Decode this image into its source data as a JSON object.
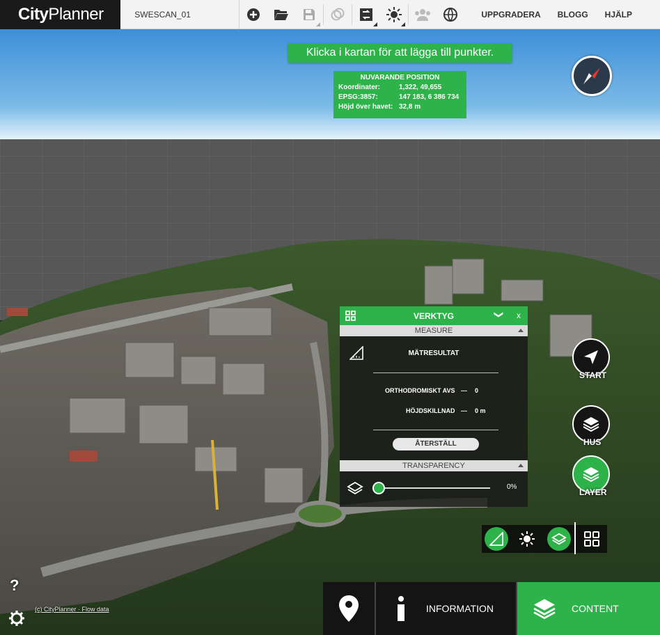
{
  "header": {
    "logo_bold": "City",
    "logo_light": "Planner",
    "project_name": "SWESCAN_01",
    "menu": [
      "UPPGRADERA",
      "BLOGG",
      "HJÄLP"
    ],
    "toolbar_icons": [
      "add-icon",
      "folder-open-icon",
      "save-icon",
      "duplicate-icon",
      "layers-swap-icon",
      "sun-icon",
      "users-icon",
      "globe-icon"
    ]
  },
  "map": {
    "instruction": "Klicka i kartan för att lägga till punkter.",
    "position": {
      "title": "NUVARANDE POSITION",
      "rows": [
        {
          "label": "Koordinater:",
          "value": "1,322, 49,655"
        },
        {
          "label": "EPSG:3857:",
          "value": "147 183, 6 386 734"
        },
        {
          "label": "Höjd över havet:",
          "value": "32,8 m"
        }
      ]
    },
    "credit": "(c) CityPlanner · Flow data"
  },
  "panel": {
    "title": "VERKTYG",
    "minimize": "❯",
    "close": "x",
    "measure_section": "MEASURE",
    "result_title": "MÄTRESULTAT",
    "ortho_label": "ORTHODROMISKT AVS",
    "ortho_dash": "---",
    "ortho_value": "0",
    "height_label": "HÖJDSKILLNAD",
    "height_dash": "---",
    "height_value": "0 m",
    "reset": "ÅTERSTÄLL",
    "transparency_section": "TRANSPARENCY",
    "transparency_value": "0%",
    "transparency_level": 0
  },
  "side_buttons": {
    "start": "START",
    "hus": "HUS",
    "layer": "LAYER"
  },
  "bottom": {
    "information": "INFORMATION",
    "content": "CONTENT"
  },
  "help": "?",
  "colors": {
    "accent": "#2db34a",
    "dark": "#141414"
  }
}
